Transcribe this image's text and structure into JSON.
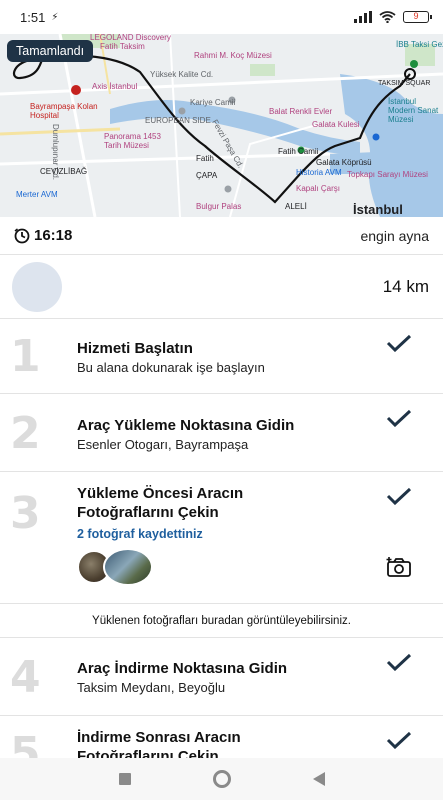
{
  "status": {
    "time": "1:51",
    "battery": "9"
  },
  "map": {
    "badge": "Tamamlandı",
    "city": "İstanbul",
    "labels": [
      "LEGOLAND Discovery",
      "Fatih Taksim",
      "Rahmi M. Koç Müzesi",
      "İBB Taksi Gezi Park",
      "Axis İstanbul",
      "Yüksek Kalite Cd.",
      "Kariye Camii",
      "Balat Renkli Evler",
      "Bayrampaşa Kolan Hospital",
      "EUROPEAN SIDE",
      "Galata Kulesi",
      "İstanbul Modern Sanat Müzesi",
      "Dumlupınar Cd.",
      "Panorama 1453 Tarih Müzesi",
      "Fevzi Paşa Cd.",
      "Fatih Camii",
      "Galata Köprüsü",
      "CEVİZLİBAĞ",
      "Fatih",
      "Historia AVM",
      "Topkapı Sarayı Müzesi",
      "ÇAPA",
      "Kapalı Çarşı",
      "Merter AVM",
      "Bulgur Palas",
      "ALELİ",
      "TAKSIM SQUAR"
    ]
  },
  "trip": {
    "duration": "16:18",
    "driver": "engin ayna",
    "distance": "14 km"
  },
  "steps": [
    {
      "num": "1",
      "title": "Hizmeti Başlatın",
      "sub": "Bu alana dokunarak işe başlayın"
    },
    {
      "num": "2",
      "title": "Araç Yükleme Noktasına Gidin",
      "sub": "Esenler Otogarı, Bayrampaşa"
    },
    {
      "num": "3",
      "title": "Yükleme Öncesi Aracın Fotoğraflarını Çekin",
      "photos": "2  fotoğraf kaydettiniz"
    },
    {
      "num": "4",
      "title": "Araç İndirme Noktasına Gidin",
      "sub": "Taksim Meydanı, Beyoğlu"
    },
    {
      "num": "5",
      "title": "İndirme Sonrası Aracın Fotoğraflarını Çekin"
    }
  ],
  "note": "Yüklenen fotoğrafları buradan görüntüleyebilirsiniz.",
  "icons": [
    "clock-icon",
    "check-icon",
    "camera-plus-icon",
    "wifi-icon",
    "signal-icon",
    "battery-icon"
  ],
  "colors": {
    "accent": "#1f3346",
    "check": "#1f3346",
    "link": "#1f5f9e"
  }
}
